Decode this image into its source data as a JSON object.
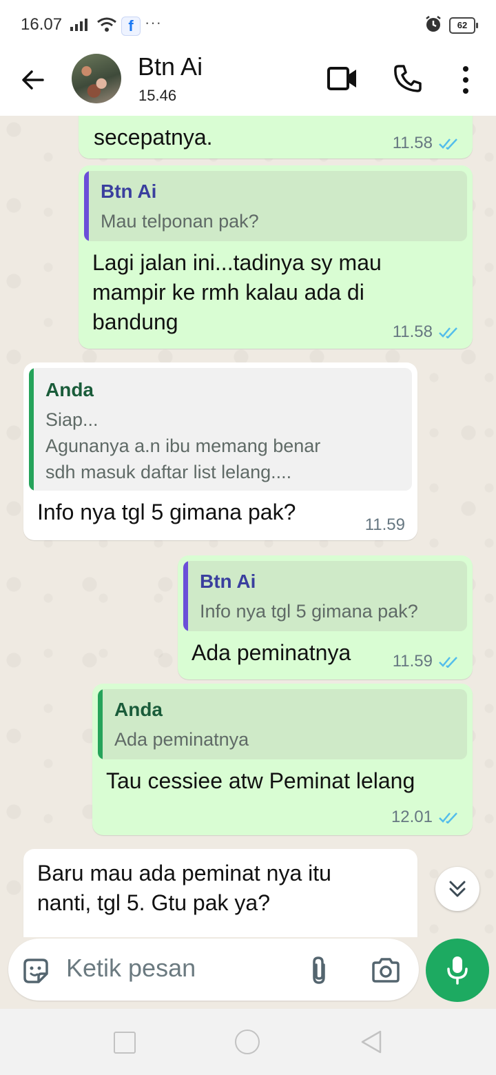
{
  "status_bar": {
    "time": "16.07",
    "fb_glyph": "f",
    "more": "···",
    "battery": "62"
  },
  "header": {
    "contact_name": "Btn Ai",
    "subtitle": "15.46"
  },
  "colors": {
    "outgoing_bubble": "#d9fdd3",
    "incoming_bubble": "#ffffff",
    "read_ticks": "#53bdeb",
    "quote_bar_contact": "#6b4fd8",
    "quote_bar_self": "#25a35a",
    "accent_green": "#1daa61"
  },
  "messages": [
    {
      "direction": "out",
      "text": "secepatnya.",
      "time": "11.58",
      "status": "read"
    },
    {
      "direction": "out",
      "quote": {
        "name": "Btn Ai",
        "text": "Mau telponan pak?"
      },
      "text": "Lagi jalan ini...tadinya sy mau\nmampir ke rmh kalau ada di\nbandung",
      "time": "11.58",
      "status": "read"
    },
    {
      "direction": "in",
      "quote": {
        "name": "Anda",
        "text": "Siap...\nAgunanya a.n ibu memang benar\nsdh masuk daftar list lelang...."
      },
      "text": "Info nya tgl 5 gimana pak?",
      "time": "11.59"
    },
    {
      "direction": "out",
      "quote": {
        "name": "Btn Ai",
        "text": "Info nya tgl 5 gimana pak?"
      },
      "text": "Ada peminatnya",
      "time": "11.59",
      "status": "read"
    },
    {
      "direction": "out",
      "quote": {
        "name": "Anda",
        "text": "Ada peminatnya"
      },
      "text": "Tau cessiee atw Peminat lelang",
      "time": "12.01",
      "status": "read"
    },
    {
      "direction": "in",
      "text": "Baru mau ada peminat nya itu\nnanti, tgl 5. Gtu pak ya?"
    }
  ],
  "composer": {
    "placeholder": "Ketik pesan"
  },
  "icons": {
    "back": "arrow-left-icon",
    "video": "video-camera-icon",
    "call": "phone-icon",
    "menu": "more-vertical-icon",
    "sticker": "sticker-icon",
    "attach": "paperclip-icon",
    "camera": "camera-icon",
    "mic": "microphone-icon",
    "scroll_down": "double-chevron-down-icon"
  }
}
